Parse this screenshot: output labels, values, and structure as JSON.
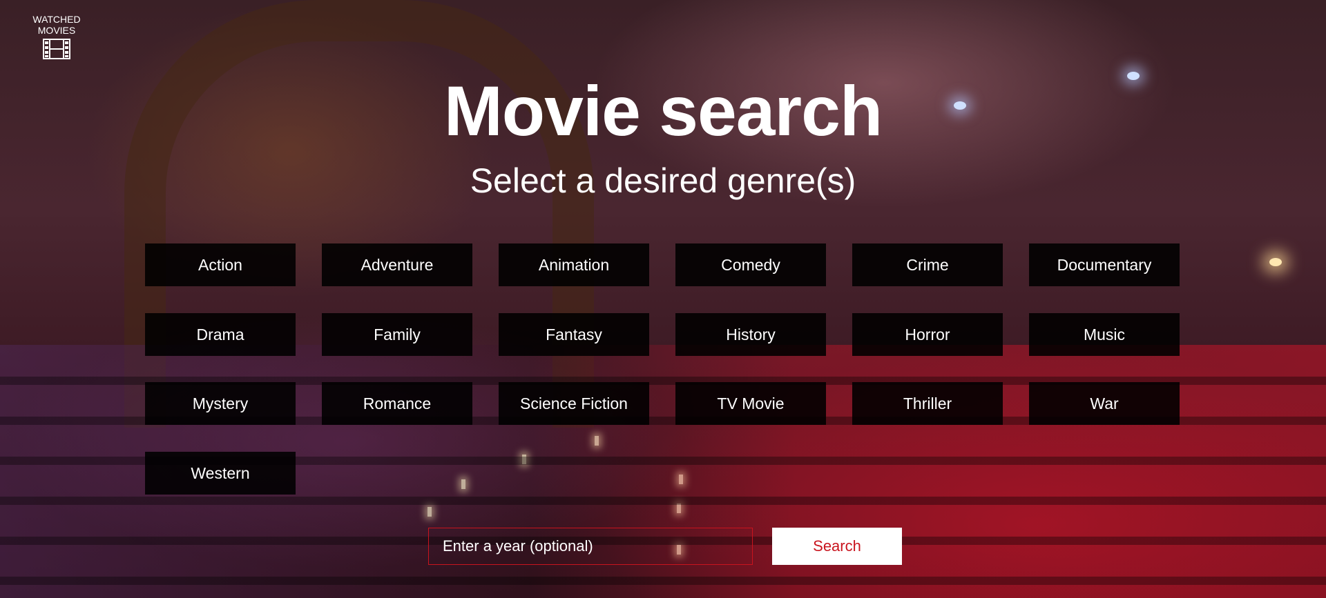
{
  "watched": {
    "label_line1": "WATCHED",
    "label_line2": "MOVIES",
    "icon": "film-icon"
  },
  "title": "Movie search",
  "subtitle": "Select a desired genre(s)",
  "genres": [
    "Action",
    "Adventure",
    "Animation",
    "Comedy",
    "Crime",
    "Documentary",
    "Drama",
    "Family",
    "Fantasy",
    "History",
    "Horror",
    "Music",
    "Mystery",
    "Romance",
    "Science Fiction",
    "TV Movie",
    "Thriller",
    "War",
    "Western"
  ],
  "search": {
    "placeholder": "Enter a year (optional)",
    "value": "",
    "button_label": "Search"
  },
  "colors": {
    "accent": "#c9141e",
    "genre_bg": "#000000"
  }
}
